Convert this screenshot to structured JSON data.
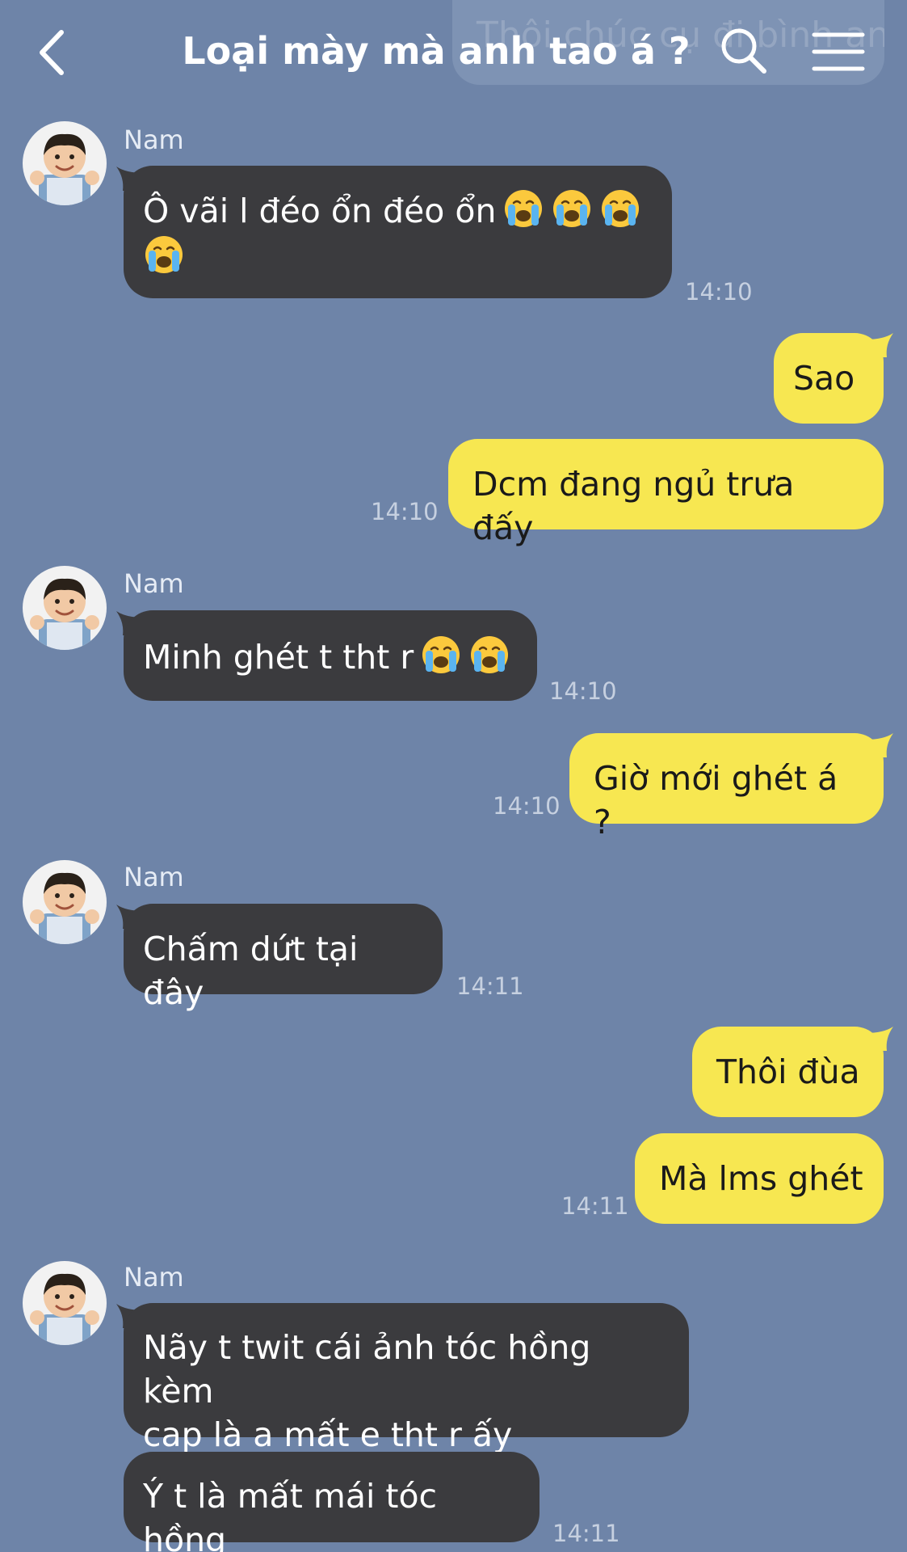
{
  "header": {
    "title": "Loại mày mà anh tao á ?",
    "ghost_text": "Thôi chúc cụ đi bình an",
    "back_icon": "chevron-left-icon",
    "search_icon": "search-icon",
    "menu_icon": "hamburger-menu-icon"
  },
  "colors": {
    "background": "#6e84a8",
    "incoming_bubble": "#3b3b3e",
    "outgoing_bubble": "#f7e751"
  },
  "messages": [
    {
      "sender": "Nam",
      "text": "Ô vãi l đéo ổn đéo ổn",
      "text2": "",
      "emoji_count": 4,
      "time": "14:10"
    },
    {
      "text": "Sao"
    },
    {
      "text": "Dcm đang ngủ trưa đấy",
      "time": "14:10"
    },
    {
      "sender": "Nam",
      "text": "Minh ghét t tht r",
      "emoji_count": 2,
      "time": "14:10"
    },
    {
      "text": "Giờ mới ghét á ?",
      "time": "14:10"
    },
    {
      "sender": "Nam",
      "text": "Chấm dứt tại đây",
      "time": "14:11"
    },
    {
      "text": "Thôi đùa"
    },
    {
      "text": "Mà lms ghét",
      "time": "14:11"
    },
    {
      "sender": "Nam",
      "text": "Nãy t twit cái ảnh tóc hồng kèm",
      "text2": "cap là a mất e tht r ấy"
    },
    {
      "text": "Ý t là mất mái tóc hồng",
      "time": "14:11"
    }
  ]
}
